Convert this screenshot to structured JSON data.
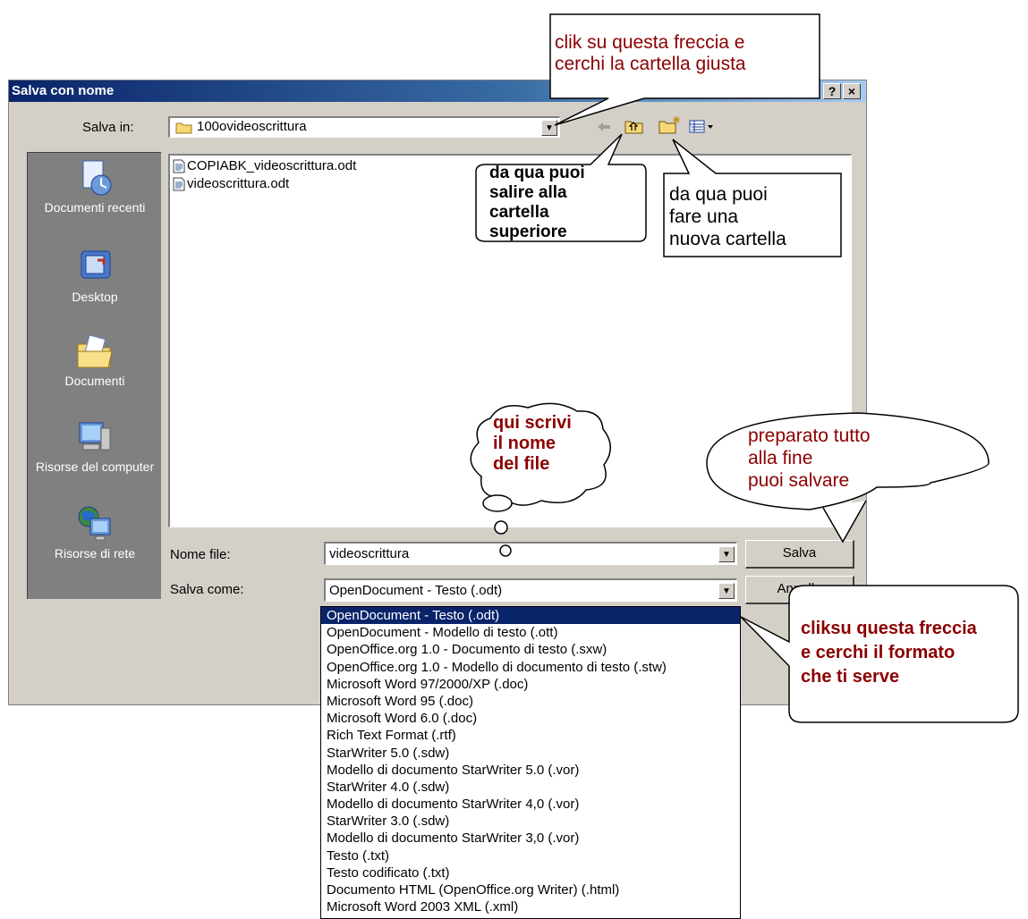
{
  "dialog": {
    "title": "Salva con nome",
    "help_glyph": "?",
    "close_glyph": "×"
  },
  "save_in": {
    "label": "Salva in:",
    "folder": "100ovideoscrittura"
  },
  "places": [
    {
      "label": "Documenti recenti",
      "icon": "recent-documents-icon"
    },
    {
      "label": "Desktop",
      "icon": "desktop-icon"
    },
    {
      "label": "Documenti",
      "icon": "documents-folder-icon"
    },
    {
      "label": "Risorse del computer",
      "icon": "my-computer-icon"
    },
    {
      "label": "Risorse di rete",
      "icon": "network-icon"
    }
  ],
  "files": [
    {
      "name": "COPIABK_videoscrittura.odt"
    },
    {
      "name": "videoscrittura.odt"
    }
  ],
  "filename": {
    "label": "Nome file:",
    "value": "videoscrittura"
  },
  "save_as": {
    "label": "Salva come:",
    "value": "OpenDocument - Testo (.odt)"
  },
  "buttons": {
    "save": "Salva",
    "cancel": "Annulla"
  },
  "format_options": [
    "OpenDocument - Testo (.odt)",
    "OpenDocument - Modello di testo (.ott)",
    "OpenOffice.org 1.0 - Documento di testo (.sxw)",
    "OpenOffice.org 1.0 - Modello di documento di testo (.stw)",
    "Microsoft Word 97/2000/XP (.doc)",
    "Microsoft Word 95 (.doc)",
    "Microsoft Word 6.0 (.doc)",
    "Rich Text Format (.rtf)",
    "StarWriter 5.0 (.sdw)",
    "Modello di documento StarWriter 5.0 (.vor)",
    "StarWriter 4.0 (.sdw)",
    "Modello di documento StarWriter 4,0 (.vor)",
    "StarWriter 3.0 (.sdw)",
    "Modello di documento StarWriter 3,0 (.vor)",
    "Testo (.txt)",
    "Testo codificato (.txt)",
    "Documento HTML (OpenOffice.org Writer) (.html)",
    "Microsoft Word 2003 XML (.xml)"
  ],
  "callouts": {
    "folder_arrow": [
      "clik su questa freccia e",
      "cerchi la cartella giusta"
    ],
    "up_folder": [
      "da qua puoi",
      "salire alla",
      "cartella",
      "superiore"
    ],
    "new_folder": [
      "da qua puoi",
      "fare una",
      "nuova cartella"
    ],
    "filename_hint": [
      "qui scrivi",
      "il nome",
      "del file"
    ],
    "save_hint": [
      "preparato tutto",
      "alla fine",
      "puoi salvare"
    ],
    "format_hint": [
      "cliksu questa freccia",
      "e cerchi il formato",
      "che ti serve"
    ]
  },
  "colors": {
    "titlebar": "#0a246a",
    "dialog_bg": "#d4d0c8",
    "callout_text": "#8b0000",
    "selection": "#0a246a"
  }
}
